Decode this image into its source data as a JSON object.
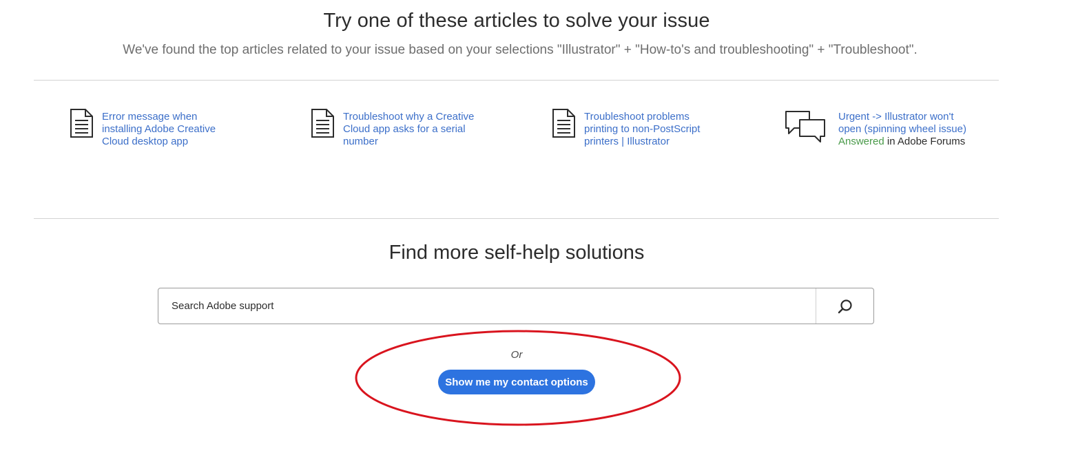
{
  "header": {
    "title": "Try one of these articles to solve your issue",
    "subtitle": "We've found the top articles related to your issue based on your selections \"Illustrator\" + \"How-to's and troubleshooting\" + \"Troubleshoot\"."
  },
  "articles": [
    {
      "icon": "document-icon",
      "lines": [
        "Error message when",
        "installing Adobe Creative",
        "Cloud desktop app"
      ]
    },
    {
      "icon": "document-icon",
      "lines": [
        "Troubleshoot why a Creative",
        "Cloud app asks for a serial",
        "number"
      ]
    },
    {
      "icon": "document-icon",
      "lines": [
        "Troubleshoot problems",
        "printing to non-PostScript",
        "printers | Illustrator"
      ]
    }
  ],
  "forum_post": {
    "icon": "chat-bubbles-icon",
    "lines": [
      "Urgent -> Illustrator won't",
      "open (spinning wheel issue)"
    ],
    "status": "Answered",
    "source": "in Adobe Forums"
  },
  "self_help": {
    "title": "Find more self-help solutions",
    "search_placeholder": "Search Adobe support",
    "search_icon": "search-icon"
  },
  "or_label": "Or",
  "contact_button": "Show me my contact options",
  "colors": {
    "link": "#3c6fc9",
    "answered": "#4a9a4a",
    "button": "#2d73e0",
    "annotation": "#d9141e"
  }
}
